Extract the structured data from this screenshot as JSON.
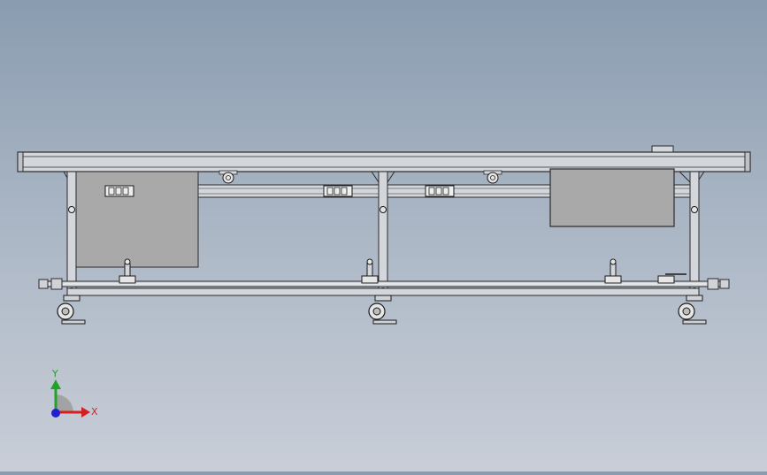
{
  "viewport": {
    "background_top": "#8a9cb0",
    "background_bottom": "#c9ced8",
    "model": "conveyor-frame-front-view"
  },
  "triad": {
    "x_label": "X",
    "y_label": "Y",
    "x_color": "#d42020",
    "y_color": "#22a22a",
    "z_color": "#2020d0"
  },
  "colors": {
    "frame_fill": "#cfd3d8",
    "frame_stroke": "#2b2b2b",
    "panel_fill": "#a9a9a9",
    "roller_fill": "#e6e6e6"
  }
}
